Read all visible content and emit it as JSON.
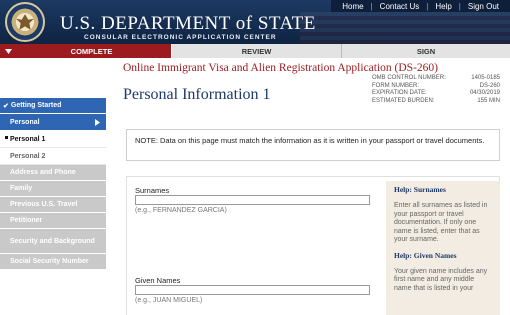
{
  "header": {
    "title": "U.S. DEPARTMENT of STATE",
    "subtitle": "CONSULAR ELECTRONIC APPLICATION CENTER",
    "links": [
      "Home",
      "Contact Us",
      "Help",
      "Sign Out"
    ]
  },
  "progress": {
    "steps": [
      "COMPLETE",
      "REVIEW",
      "SIGN"
    ],
    "active_color": "#9c1b1f"
  },
  "sidebar": {
    "getting_started": "Getting Started",
    "personal": "Personal",
    "personal_1": "Personal 1",
    "personal_2": "Personal 2",
    "items": [
      "Address and Phone",
      "Family",
      "Previous U.S. Travel",
      "Petitioner",
      "Security and Background",
      "Social Security Number"
    ]
  },
  "main": {
    "form_title": "Online Immigrant Visa and Alien Registration Application (DS-260)",
    "page_heading": "Personal Information 1",
    "omb": [
      {
        "k": "OMB CONTROL NUMBER:",
        "v": "1405-0185"
      },
      {
        "k": "FORM NUMBER:",
        "v": "DS-260"
      },
      {
        "k": "EXPIRATION DATE:",
        "v": "04/30/2019"
      },
      {
        "k": "ESTIMATED BURDEN:",
        "v": "155 MIN"
      }
    ],
    "note": "NOTE: Data on this page must match the information as it is written in your passport or travel documents.",
    "surnames_label": "Surnames",
    "surnames_hint": "(e.g., FERNANDEZ GARCIA)",
    "surnames_value": "",
    "given_label": "Given Names",
    "given_hint": "(e.g., JUAN MIGUEL)",
    "given_value": ""
  },
  "help": {
    "prefix": "Help:",
    "surnames_title": "Surnames",
    "surnames_text": "Enter all surnames as listed in your passport or travel documentation. If only one name is listed, enter that as your surname.",
    "given_title": "Given Names",
    "given_text": "Your given name includes any first name and any middle name that is listed in your"
  }
}
